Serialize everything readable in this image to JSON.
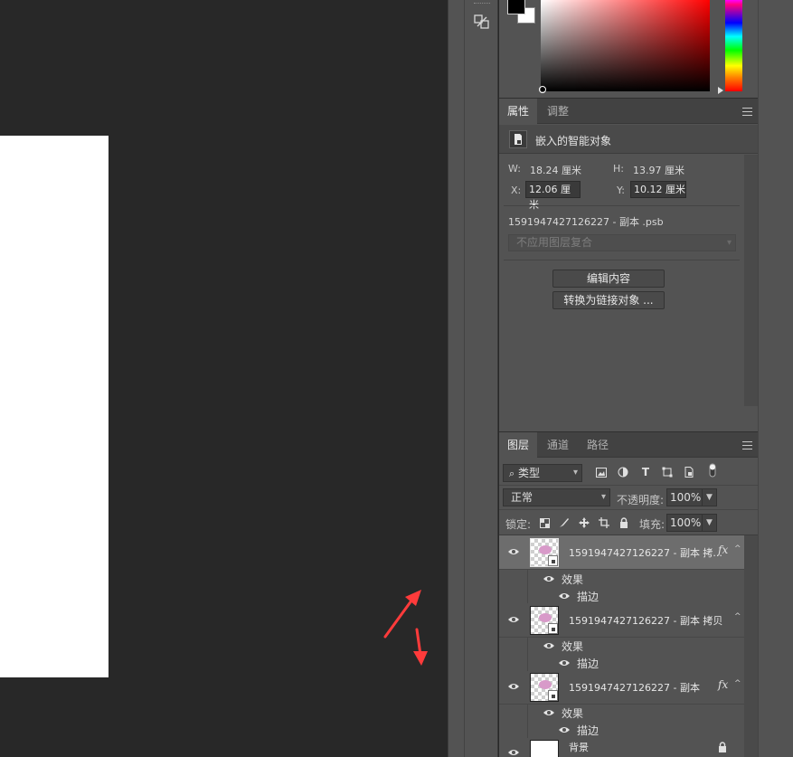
{
  "icons": {
    "tool": "smart-object-transform-icon",
    "smart_object": "smart-object-icon",
    "eye": "eye-icon",
    "menu": "hamburger-menu-icon",
    "search": "search-icon",
    "lock": "lock-icon",
    "arrows": "red-arrow-icon"
  },
  "colors": {
    "canvas": "#282828",
    "panel": "#535353",
    "tab_bar": "#424242",
    "arrow": "#ff3b3b",
    "selected_row": "#6d6d6d"
  },
  "properties": {
    "tabs": [
      "属性",
      "调整"
    ],
    "active_tab": "属性",
    "title": "嵌入的智能对象",
    "w_label": "W:",
    "w_value": "18.24 厘米",
    "h_label": "H:",
    "h_value": "13.97 厘米",
    "x_label": "X:",
    "x_value": "12.06 厘米",
    "y_label": "Y:",
    "y_value": "10.12 厘米",
    "filename": "1591947427126227  - 副本 .psb",
    "layer_comp_placeholder": "不应用图层复合",
    "edit_button": "编辑内容",
    "convert_button": "转换为链接对象 ..."
  },
  "layers_panel": {
    "tabs": [
      "图层",
      "通道",
      "路径"
    ],
    "active_tab": "图层",
    "filter_type": "类型",
    "blend_mode": "正常",
    "opacity_label": "不透明度:",
    "opacity_value": "100%",
    "lock_label": "锁定:",
    "fill_label": "填充:",
    "fill_value": "100%",
    "layers": [
      {
        "name": "1591947427126227  - 副本 拷...",
        "fx": "fx",
        "selected": true,
        "effects_label": "效果",
        "effect_item": "描边"
      },
      {
        "name": "1591947427126227  - 副本 拷贝",
        "fx": "",
        "selected": false,
        "effects_label": "效果",
        "effect_item": "描边"
      },
      {
        "name": "1591947427126227  - 副本",
        "fx": "fx",
        "selected": false,
        "effects_label": "效果",
        "effect_item": "描边"
      },
      {
        "name": "背景",
        "fx": "",
        "selected": false,
        "effects_label": "",
        "effect_item": ""
      }
    ]
  }
}
